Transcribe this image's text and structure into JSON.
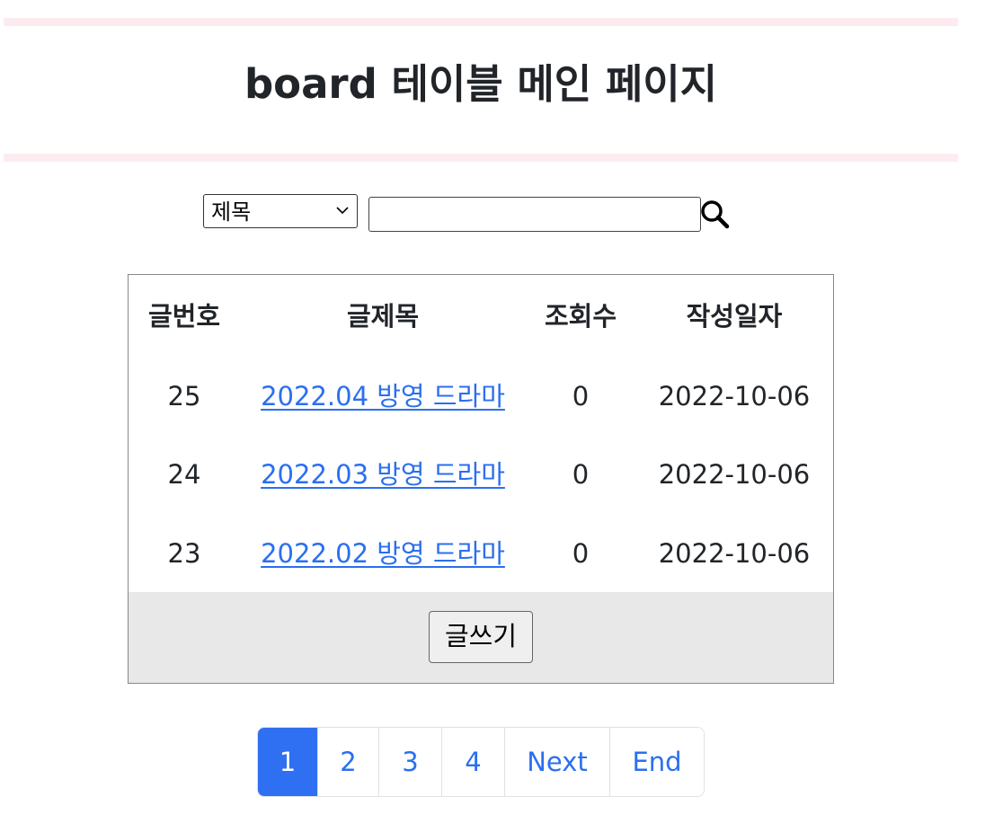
{
  "header": {
    "title": "board 테이블 메인 페이지"
  },
  "search": {
    "field_selected": "제목",
    "query_value": "",
    "icon": "search-icon"
  },
  "table": {
    "columns": [
      "글번호",
      "글제목",
      "조회수",
      "작성일자"
    ],
    "rows": [
      {
        "no": "25",
        "title": "2022.04 방영 드라마",
        "views": "0",
        "date": "2022-10-06"
      },
      {
        "no": "24",
        "title": "2022.03 방영 드라마",
        "views": "0",
        "date": "2022-10-06"
      },
      {
        "no": "23",
        "title": "2022.02 방영 드라마",
        "views": "0",
        "date": "2022-10-06"
      }
    ],
    "write_label": "글쓰기"
  },
  "pagination": {
    "items": [
      "1",
      "2",
      "3",
      "4",
      "Next",
      "End"
    ],
    "active": "1"
  },
  "colors": {
    "accent": "#2f6ff2",
    "link": "#2a6ff0",
    "rule": "#fdecef",
    "footer_bg": "#e8e8e8"
  }
}
